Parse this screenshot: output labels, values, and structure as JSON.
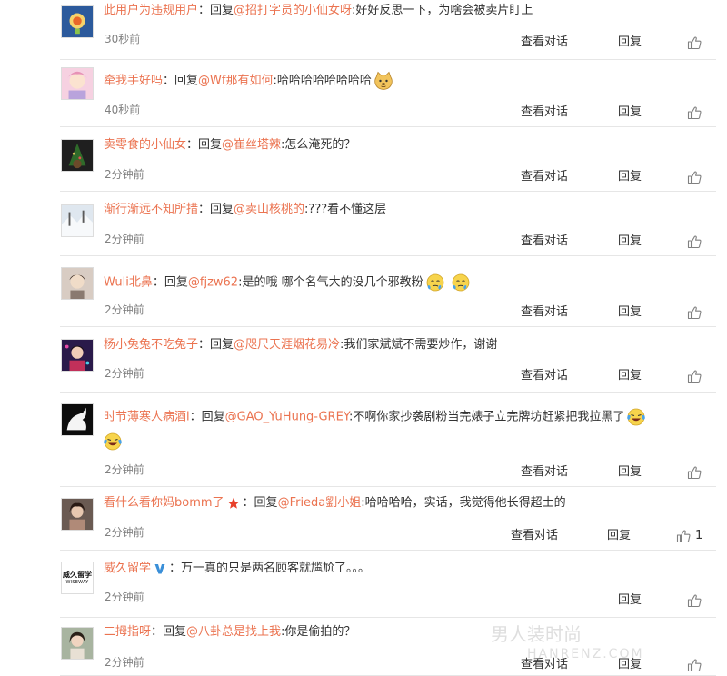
{
  "comments": [
    {
      "user": "此用户为违规用户",
      "reply_prefix": "：回复",
      "mention": "@招打字员的小仙女呀",
      "content": ":好好反思一下，为啥会被卖片盯上",
      "time": "30秒前",
      "view_dialog": "查看对话",
      "reply": "回复"
    },
    {
      "user": "牵我手好吗",
      "reply_prefix": "：回复",
      "mention": "@Wf那有如何",
      "content": ":哈哈哈哈哈哈哈哈",
      "time": "40秒前",
      "view_dialog": "查看对话",
      "reply": "回复"
    },
    {
      "user": "卖零食的小仙女",
      "reply_prefix": "：回复",
      "mention": "@崔丝塔辣",
      "content": ":怎么淹死的？",
      "time": "2分钟前",
      "view_dialog": "查看对话",
      "reply": "回复"
    },
    {
      "user": "渐行渐远不知所措",
      "reply_prefix": "：回复",
      "mention": "@卖山核桃的",
      "content": ":???看不懂这层",
      "time": "2分钟前",
      "view_dialog": "查看对话",
      "reply": "回复"
    },
    {
      "user": "Wuli北鼻",
      "reply_prefix": "：回复",
      "mention": "@fjzw62",
      "content": ":是的哦 哪个名气大的没几个邪教粉",
      "time": "2分钟前",
      "view_dialog": "查看对话",
      "reply": "回复"
    },
    {
      "user": "杨小兔兔不吃兔子",
      "reply_prefix": "：回复",
      "mention": "@咫尺天涯烟花易冷",
      "content": ":我们家斌斌不需要炒作，谢谢",
      "time": "2分钟前",
      "view_dialog": "查看对话",
      "reply": "回复"
    },
    {
      "user": "时节薄寒人病酒i",
      "reply_prefix": "：回复",
      "mention": "@GAO_YuHung-GREY",
      "content": ":不啊你家抄袭剧粉当完婊子立完牌坊赶紧把我拉黑了",
      "time": "2分钟前",
      "view_dialog": "查看对话",
      "reply": "回复"
    },
    {
      "user": "看什么看你妈bomm了",
      "reply_prefix": "：回复",
      "mention": "@Frieda劉小姐",
      "content": ":哈哈哈哈，实话，我觉得他长得超土的",
      "time": "2分钟前",
      "view_dialog": "查看对话",
      "reply": "回复",
      "likes": "1"
    },
    {
      "user": "威久留学",
      "reply_prefix": "：",
      "mention": "",
      "content": "万一真的只是两名顾客就尴尬了。。。",
      "time": "2分钟前",
      "reply": "回复",
      "avatar_text_1": "威久留学",
      "avatar_text_2": "WISEWAY"
    },
    {
      "user": "二拇指呀",
      "reply_prefix": "：回复",
      "mention": "@八卦总是找上我",
      "content": ":你是偷拍的？",
      "time": "2分钟前",
      "view_dialog": "查看对话",
      "reply": "回复"
    }
  ],
  "watermark": {
    "line1": "男人装时尚",
    "line2": "HANRENZ.COM"
  },
  "colors": {
    "link": "#eb7350",
    "text": "#333333",
    "time": "#808080",
    "divider": "#e6e6e6"
  },
  "icons": {
    "like": "thumbs-up-icon",
    "emoji_doge": "doge-emoji-icon",
    "emoji_sweat": "sweat-emoji-icon",
    "emoji_laugh_cry": "laugh-cry-emoji-icon",
    "verified": "verified-v-icon",
    "star": "red-star-icon"
  }
}
